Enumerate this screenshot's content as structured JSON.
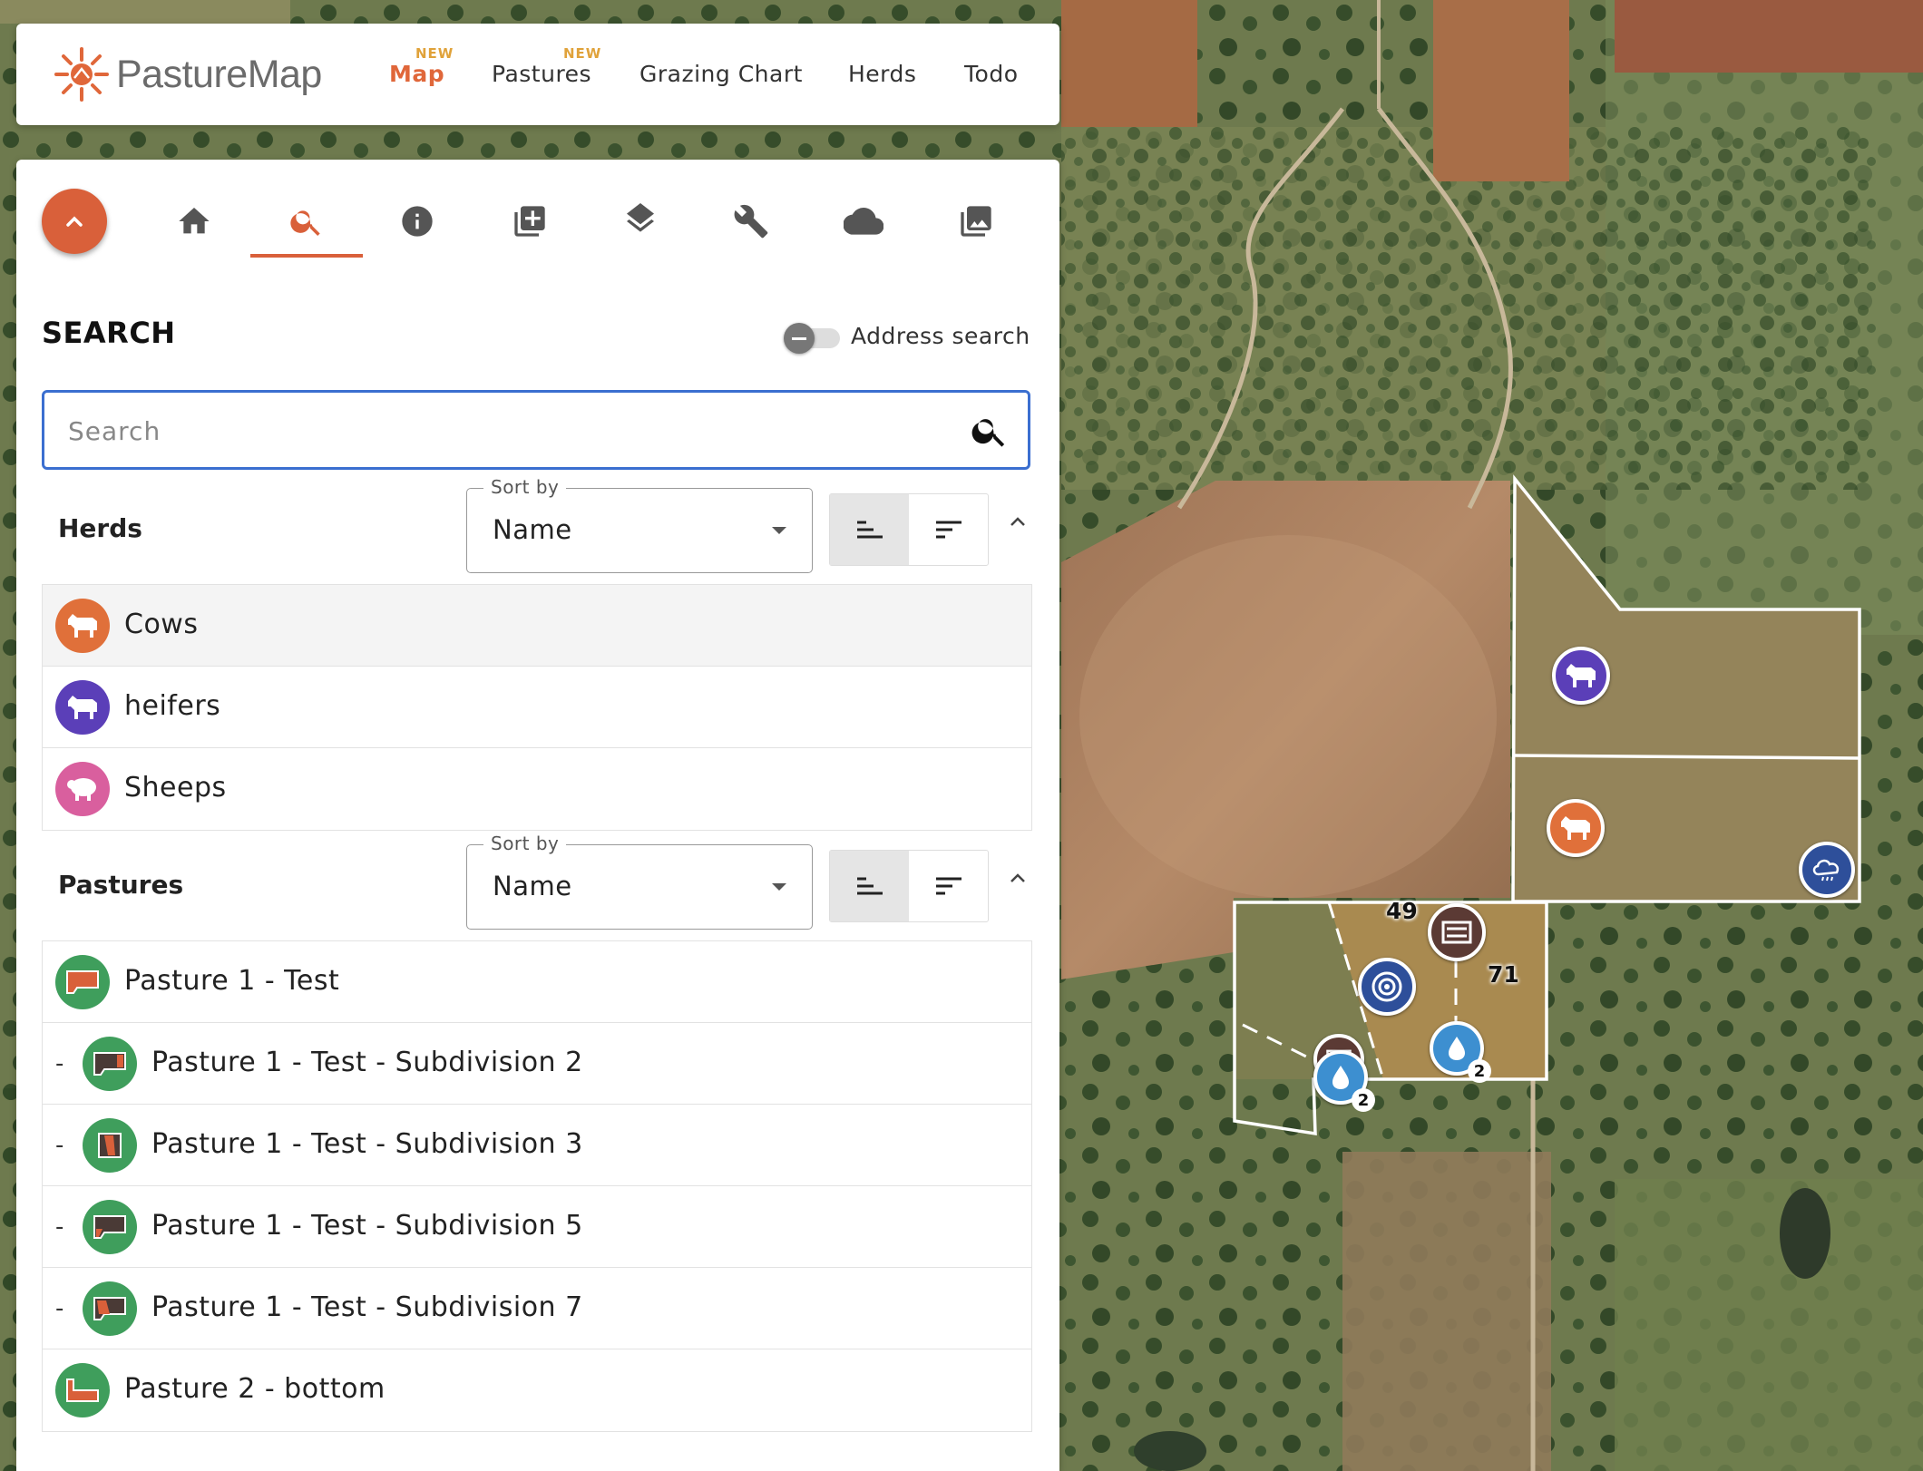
{
  "app": {
    "logo_text": "PastureMap"
  },
  "nav": {
    "items": [
      {
        "label": "Map",
        "badge": "NEW",
        "active": true
      },
      {
        "label": "Pastures",
        "badge": "NEW",
        "active": false
      },
      {
        "label": "Grazing Chart",
        "badge": "",
        "active": false
      },
      {
        "label": "Herds",
        "badge": "",
        "active": false
      },
      {
        "label": "Todo",
        "badge": "",
        "active": false
      }
    ]
  },
  "toolbar": {
    "icons": [
      "home-icon",
      "search-icon",
      "info-icon",
      "add-library-icon",
      "layers-icon",
      "wrench-icon",
      "cloud-icon",
      "photo-library-icon"
    ],
    "active_tab": "search-icon"
  },
  "search": {
    "title": "SEARCH",
    "address_toggle_label": "Address search",
    "address_toggle_on": false,
    "placeholder": "Search",
    "value": ""
  },
  "herds": {
    "title": "Herds",
    "sort_label": "Sort by",
    "sort_value": "Name",
    "items": [
      {
        "name": "Cows",
        "color": "#e0703a",
        "icon": "cow-icon",
        "selected": true
      },
      {
        "name": "heifers",
        "color": "#5b3fb8",
        "icon": "cow-icon",
        "selected": false
      },
      {
        "name": "Sheeps",
        "color": "#d95f9e",
        "icon": "sheep-icon",
        "selected": false
      }
    ]
  },
  "pastures": {
    "title": "Pastures",
    "sort_label": "Sort by",
    "sort_value": "Name",
    "items": [
      {
        "name": "Pasture 1 - Test",
        "sub": false
      },
      {
        "name": "Pasture 1 - Test - Subdivision 2",
        "sub": true
      },
      {
        "name": "Pasture 1 - Test - Subdivision 3",
        "sub": true
      },
      {
        "name": "Pasture 1 - Test - Subdivision 5",
        "sub": true
      },
      {
        "name": "Pasture 1 - Test - Subdivision 7",
        "sub": true
      },
      {
        "name": "Pasture 2 - bottom",
        "sub": false
      }
    ],
    "sub_prefix": "-"
  },
  "map": {
    "labels": {
      "a": "49",
      "b": "71"
    },
    "water_counts": {
      "a": "2",
      "b": "2"
    },
    "colors": {
      "accent": "#d9603a",
      "selection_blue": "#3b6fd0",
      "pasture_green": "#3f9e5c"
    }
  }
}
